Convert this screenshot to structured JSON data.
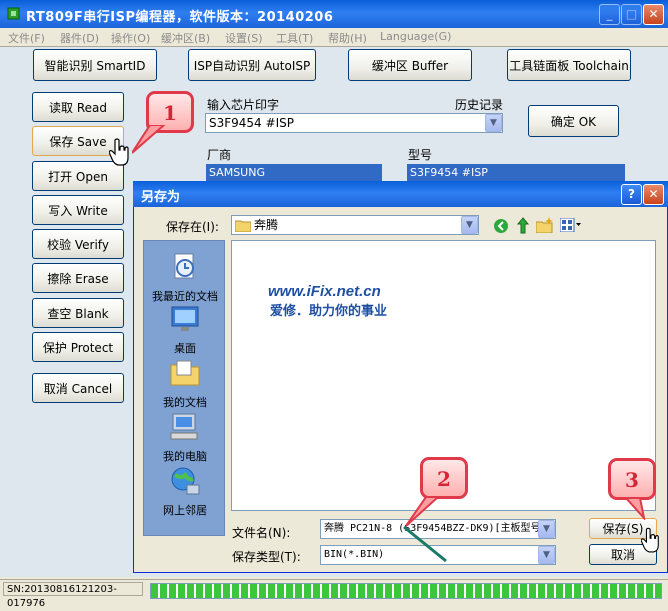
{
  "window": {
    "title": "RT809F串行ISP编程器，软件版本：20140206",
    "min": "_",
    "max": "□",
    "close": "✕"
  },
  "menu": [
    "文件(F)",
    "器件(D)",
    "操作(O)",
    "缓冲区(B)",
    "设置(S)",
    "工具(T)",
    "帮助(H)",
    "Language(G)"
  ],
  "toolbar": {
    "smart_id": "智能识别 SmartID",
    "isp_auto": "ISP自动识别 AutoISP",
    "buffer": "缓冲区 Buffer",
    "toolchain": "工具链面板 Toolchain"
  },
  "side_buttons": [
    "读取 Read",
    "保存 Save",
    "打开 Open",
    "写入 Write",
    "校验 Verify",
    "擦除 Erase",
    "查空 Blank",
    "保护 Protect",
    "取消 Cancel"
  ],
  "chip": {
    "input_label": "输入芯片印字",
    "history_label": "历史记录",
    "value": "S3F9454 #ISP",
    "ok": "确定 OK",
    "vendor_label": "厂商",
    "vendor": "SAMSUNG",
    "model_label": "型号",
    "model": "S3F9454 #ISP"
  },
  "dialog": {
    "title": "另存为",
    "help": "?",
    "close": "✕",
    "save_in_label": "保存在(I):",
    "save_in_value": "奔腾",
    "places": [
      "我最近的文档",
      "桌面",
      "我的文档",
      "我的电脑",
      "网上邻居"
    ],
    "watermark_url": "www.iFix.net.cn",
    "watermark_slogan": "爱修．助力你的事业",
    "filename_label": "文件名(N):",
    "filename_value": "奔腾 PC21N-8 (S3F9454BZZ-DK9)[主板型号*",
    "filetype_label": "保存类型(T):",
    "filetype_value": "BIN(*.BIN)",
    "save": "保存(S)",
    "cancel": "取消"
  },
  "callouts": [
    "1",
    "2",
    "3"
  ],
  "status": {
    "sn": "SN:20130816121203-017976",
    "progress": 1.0
  },
  "colors": {
    "titlebar": "#0a5fd8",
    "callout": "#e0394a",
    "panel": "#dfe7ee",
    "progress": "#3cc63c"
  }
}
